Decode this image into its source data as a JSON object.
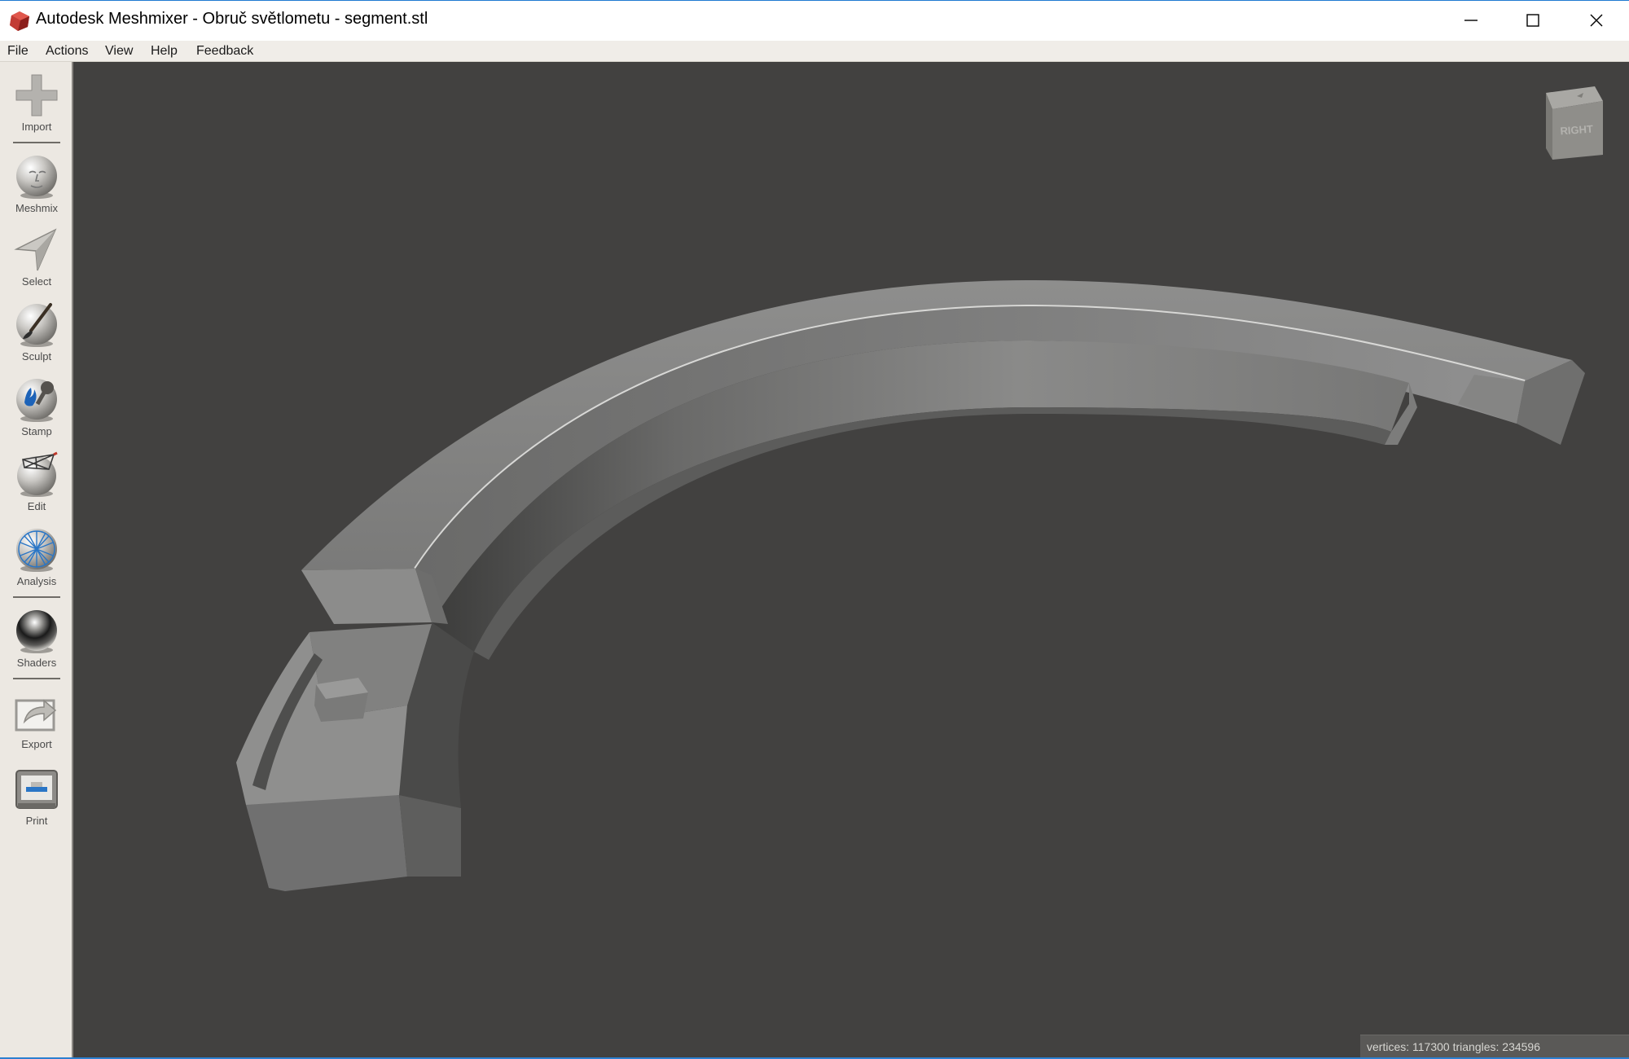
{
  "window": {
    "title": "Autodesk Meshmixer - Obruč světlometu - segment.stl",
    "app_icon": "meshmixer-logo-icon",
    "controls": {
      "minimize": "minimize-icon",
      "maximize": "maximize-icon",
      "close": "close-icon"
    }
  },
  "menu": {
    "items": [
      {
        "label": "File"
      },
      {
        "label": "Actions"
      },
      {
        "label": "View"
      },
      {
        "label": "Help"
      },
      {
        "label": "Feedback"
      }
    ]
  },
  "toolbar": {
    "tools": [
      {
        "label": "Import",
        "icon": "plus-icon"
      },
      {
        "label": "Meshmix",
        "icon": "face-sphere-icon"
      },
      {
        "label": "Select",
        "icon": "arrow-cursor-icon"
      },
      {
        "label": "Sculpt",
        "icon": "brush-sphere-icon"
      },
      {
        "label": "Stamp",
        "icon": "stamp-sphere-icon"
      },
      {
        "label": "Edit",
        "icon": "wireframe-sphere-icon"
      },
      {
        "label": "Analysis",
        "icon": "mesh-sphere-icon"
      },
      {
        "label": "Shaders",
        "icon": "chrome-sphere-icon"
      },
      {
        "label": "Export",
        "icon": "export-arrow-icon"
      },
      {
        "label": "Print",
        "icon": "printer-icon"
      }
    ]
  },
  "viewport": {
    "background": "#424140",
    "model": "3D mesh segment",
    "viewcube_label": "RIGHT",
    "status": "vertices: 117300 triangles: 234596"
  }
}
